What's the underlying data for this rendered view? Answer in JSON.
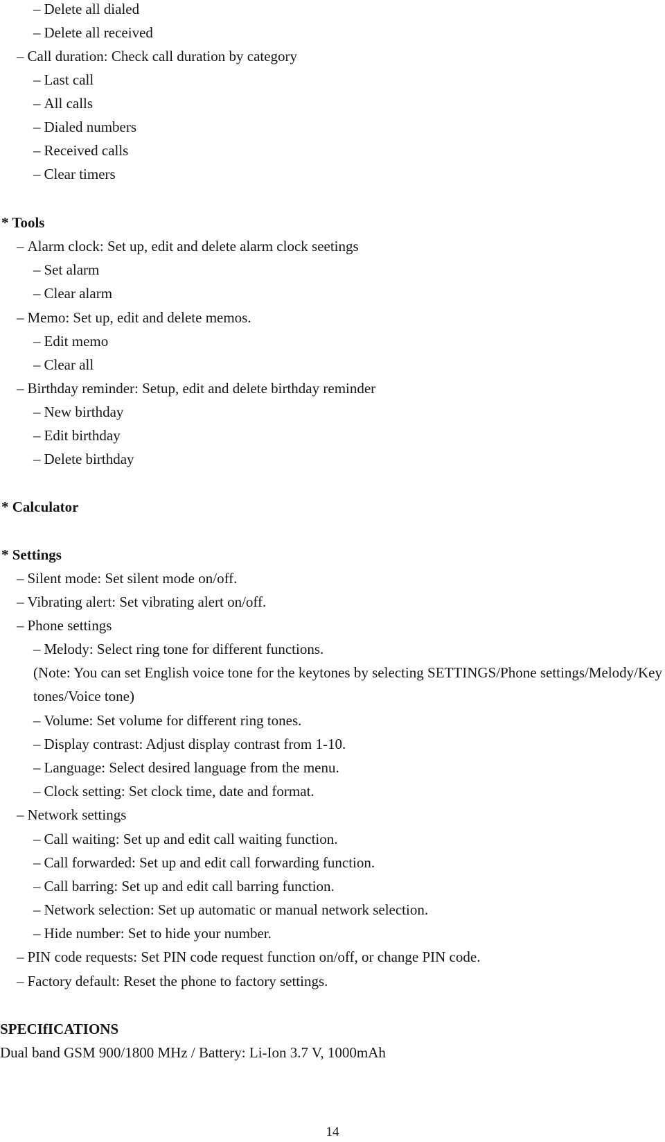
{
  "document": {
    "lines": [
      {
        "text": "Delete all dialed",
        "dash": "–"
      },
      {
        "text": "Delete all received",
        "dash": "–"
      },
      {
        "text": "Call duration: Check call duration by category",
        "dash": "–"
      },
      {
        "text": "Last call",
        "dash": "–"
      },
      {
        "text": "All calls",
        "dash": "–"
      },
      {
        "text": "Dialed numbers",
        "dash": "–"
      },
      {
        "text": "Received calls",
        "dash": "–"
      },
      {
        "text": "Clear timers",
        "dash": "–"
      }
    ],
    "tools": {
      "heading": "* Tools",
      "items": [
        {
          "text": "Alarm clock: Set up, edit and delete alarm clock seetings",
          "dash": "–"
        },
        {
          "text": "Set alarm",
          "dash": "–"
        },
        {
          "text": "Clear alarm",
          "dash": "–"
        },
        {
          "text": "Memo: Set up, edit and delete memos.",
          "dash": "–"
        },
        {
          "text": "Edit memo",
          "dash": "–"
        },
        {
          "text": "Clear all",
          "dash": "–"
        },
        {
          "text": "Birthday reminder: Setup, edit and delete birthday reminder",
          "dash": "–"
        },
        {
          "text": "New birthday",
          "dash": "–"
        },
        {
          "text": "Edit birthday",
          "dash": "–"
        },
        {
          "text": "Delete birthday",
          "dash": "–"
        }
      ]
    },
    "calculator": {
      "heading": "* Calculator"
    },
    "settings": {
      "heading": "* Settings",
      "items": [
        {
          "text": "Silent mode: Set silent mode on/off.",
          "dash": "–"
        },
        {
          "text": "Vibrating alert: Set vibrating alert on/off.",
          "dash": "–"
        },
        {
          "text": "Phone settings",
          "dash": "–"
        },
        {
          "text": "Melody: Select ring tone for different functions.",
          "dash": "–"
        },
        {
          "text": "Volume: Set volume for different ring tones.",
          "dash": "–"
        },
        {
          "text": "Display contrast: Adjust display contrast from 1-10.",
          "dash": "–"
        },
        {
          "text": "Language: Select desired language from the menu.",
          "dash": "–"
        },
        {
          "text": "Clock setting: Set clock time, date and format.",
          "dash": "–"
        },
        {
          "text": "Network settings",
          "dash": "–"
        },
        {
          "text": "Call waiting: Set up and edit call waiting function.",
          "dash": "–"
        },
        {
          "text": "Call forwarded: Set up and edit call forwarding function.",
          "dash": "–"
        },
        {
          "text": "Call barring: Set up and edit call barring function.",
          "dash": "–"
        },
        {
          "text": "Network selection: Set up automatic or manual network selection.",
          "dash": "–"
        },
        {
          "text": "Hide number: Set to hide your number.",
          "dash": "–"
        },
        {
          "text": "PIN code requests: Set PIN code request function on/off, or change PIN code.",
          "dash": "–"
        },
        {
          "text": "Factory default: Reset the phone to factory settings.",
          "dash": "–"
        }
      ],
      "note": "(Note: You can set English voice tone for the keytones by selecting SETTINGS/Phone settings/Melody/Key tones/Voice tone)"
    },
    "specifications": {
      "heading": "SPECIfICATIONS",
      "text": "Dual band GSM 900/1800 MHz / Battery: Li-Ion 3.7 V, 1000mAh"
    },
    "page_number": "14"
  }
}
